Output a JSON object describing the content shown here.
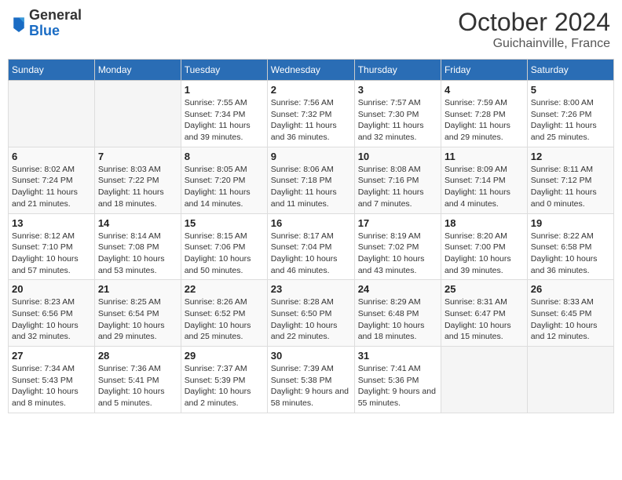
{
  "header": {
    "logo_general": "General",
    "logo_blue": "Blue",
    "month_title": "October 2024",
    "location": "Guichainville, France"
  },
  "weekdays": [
    "Sunday",
    "Monday",
    "Tuesday",
    "Wednesday",
    "Thursday",
    "Friday",
    "Saturday"
  ],
  "weeks": [
    [
      {
        "day": "",
        "info": ""
      },
      {
        "day": "",
        "info": ""
      },
      {
        "day": "1",
        "info": "Sunrise: 7:55 AM\nSunset: 7:34 PM\nDaylight: 11 hours and 39 minutes."
      },
      {
        "day": "2",
        "info": "Sunrise: 7:56 AM\nSunset: 7:32 PM\nDaylight: 11 hours and 36 minutes."
      },
      {
        "day": "3",
        "info": "Sunrise: 7:57 AM\nSunset: 7:30 PM\nDaylight: 11 hours and 32 minutes."
      },
      {
        "day": "4",
        "info": "Sunrise: 7:59 AM\nSunset: 7:28 PM\nDaylight: 11 hours and 29 minutes."
      },
      {
        "day": "5",
        "info": "Sunrise: 8:00 AM\nSunset: 7:26 PM\nDaylight: 11 hours and 25 minutes."
      }
    ],
    [
      {
        "day": "6",
        "info": "Sunrise: 8:02 AM\nSunset: 7:24 PM\nDaylight: 11 hours and 21 minutes."
      },
      {
        "day": "7",
        "info": "Sunrise: 8:03 AM\nSunset: 7:22 PM\nDaylight: 11 hours and 18 minutes."
      },
      {
        "day": "8",
        "info": "Sunrise: 8:05 AM\nSunset: 7:20 PM\nDaylight: 11 hours and 14 minutes."
      },
      {
        "day": "9",
        "info": "Sunrise: 8:06 AM\nSunset: 7:18 PM\nDaylight: 11 hours and 11 minutes."
      },
      {
        "day": "10",
        "info": "Sunrise: 8:08 AM\nSunset: 7:16 PM\nDaylight: 11 hours and 7 minutes."
      },
      {
        "day": "11",
        "info": "Sunrise: 8:09 AM\nSunset: 7:14 PM\nDaylight: 11 hours and 4 minutes."
      },
      {
        "day": "12",
        "info": "Sunrise: 8:11 AM\nSunset: 7:12 PM\nDaylight: 11 hours and 0 minutes."
      }
    ],
    [
      {
        "day": "13",
        "info": "Sunrise: 8:12 AM\nSunset: 7:10 PM\nDaylight: 10 hours and 57 minutes."
      },
      {
        "day": "14",
        "info": "Sunrise: 8:14 AM\nSunset: 7:08 PM\nDaylight: 10 hours and 53 minutes."
      },
      {
        "day": "15",
        "info": "Sunrise: 8:15 AM\nSunset: 7:06 PM\nDaylight: 10 hours and 50 minutes."
      },
      {
        "day": "16",
        "info": "Sunrise: 8:17 AM\nSunset: 7:04 PM\nDaylight: 10 hours and 46 minutes."
      },
      {
        "day": "17",
        "info": "Sunrise: 8:19 AM\nSunset: 7:02 PM\nDaylight: 10 hours and 43 minutes."
      },
      {
        "day": "18",
        "info": "Sunrise: 8:20 AM\nSunset: 7:00 PM\nDaylight: 10 hours and 39 minutes."
      },
      {
        "day": "19",
        "info": "Sunrise: 8:22 AM\nSunset: 6:58 PM\nDaylight: 10 hours and 36 minutes."
      }
    ],
    [
      {
        "day": "20",
        "info": "Sunrise: 8:23 AM\nSunset: 6:56 PM\nDaylight: 10 hours and 32 minutes."
      },
      {
        "day": "21",
        "info": "Sunrise: 8:25 AM\nSunset: 6:54 PM\nDaylight: 10 hours and 29 minutes."
      },
      {
        "day": "22",
        "info": "Sunrise: 8:26 AM\nSunset: 6:52 PM\nDaylight: 10 hours and 25 minutes."
      },
      {
        "day": "23",
        "info": "Sunrise: 8:28 AM\nSunset: 6:50 PM\nDaylight: 10 hours and 22 minutes."
      },
      {
        "day": "24",
        "info": "Sunrise: 8:29 AM\nSunset: 6:48 PM\nDaylight: 10 hours and 18 minutes."
      },
      {
        "day": "25",
        "info": "Sunrise: 8:31 AM\nSunset: 6:47 PM\nDaylight: 10 hours and 15 minutes."
      },
      {
        "day": "26",
        "info": "Sunrise: 8:33 AM\nSunset: 6:45 PM\nDaylight: 10 hours and 12 minutes."
      }
    ],
    [
      {
        "day": "27",
        "info": "Sunrise: 7:34 AM\nSunset: 5:43 PM\nDaylight: 10 hours and 8 minutes."
      },
      {
        "day": "28",
        "info": "Sunrise: 7:36 AM\nSunset: 5:41 PM\nDaylight: 10 hours and 5 minutes."
      },
      {
        "day": "29",
        "info": "Sunrise: 7:37 AM\nSunset: 5:39 PM\nDaylight: 10 hours and 2 minutes."
      },
      {
        "day": "30",
        "info": "Sunrise: 7:39 AM\nSunset: 5:38 PM\nDaylight: 9 hours and 58 minutes."
      },
      {
        "day": "31",
        "info": "Sunrise: 7:41 AM\nSunset: 5:36 PM\nDaylight: 9 hours and 55 minutes."
      },
      {
        "day": "",
        "info": ""
      },
      {
        "day": "",
        "info": ""
      }
    ]
  ]
}
